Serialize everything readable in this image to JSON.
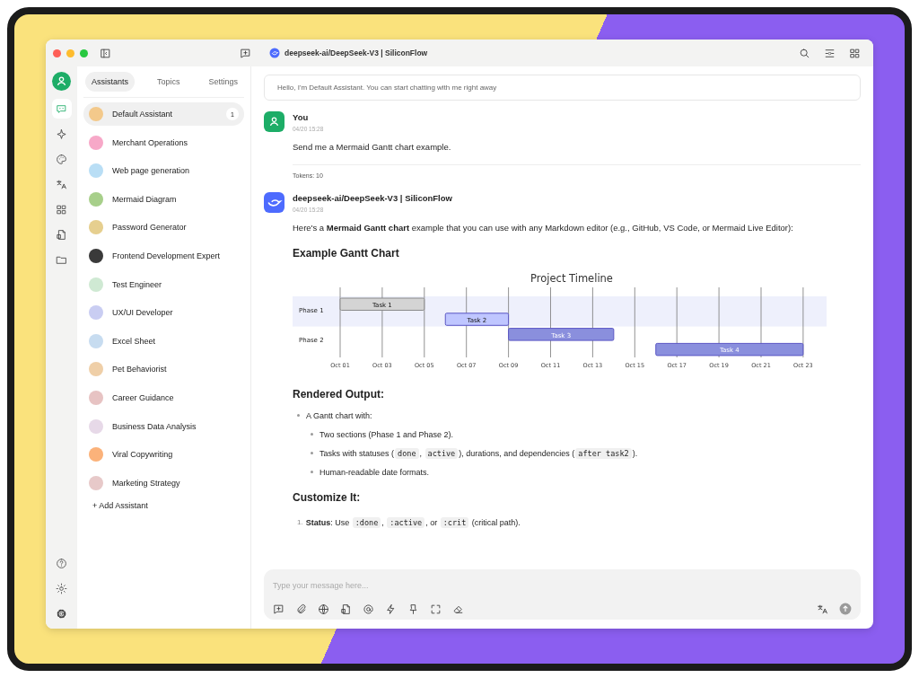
{
  "window": {
    "title": "deepseek-ai/DeepSeek-V3 | SiliconFlow"
  },
  "rail": {
    "top": [
      {
        "selected": true
      },
      {
        "selected": false
      },
      {
        "selected": false
      },
      {
        "selected": false
      },
      {
        "selected": false
      },
      {
        "selected": false
      },
      {
        "selected": false
      }
    ]
  },
  "sidebar": {
    "tabs": [
      {
        "label": "Assistants",
        "selected": true
      },
      {
        "label": "Topics",
        "selected": false
      },
      {
        "label": "Settings",
        "selected": false
      }
    ],
    "items": [
      {
        "label": "Default Assistant",
        "selected": true,
        "badge": "1",
        "color": "#f3c98b"
      },
      {
        "label": "Merchant Operations",
        "selected": false,
        "color": "#f7a8c8"
      },
      {
        "label": "Web page generation",
        "selected": false,
        "color": "#b9def5"
      },
      {
        "label": "Mermaid Diagram",
        "selected": false,
        "color": "#a7cf8a"
      },
      {
        "label": "Password Generator",
        "selected": false,
        "color": "#e6cf8f"
      },
      {
        "label": "Frontend Development Expert",
        "selected": false,
        "color": "#3a3a3a"
      },
      {
        "label": "Test Engineer",
        "selected": false,
        "color": "#cfe9d3"
      },
      {
        "label": "UX/UI Developer",
        "selected": false,
        "color": "#c9cdf2"
      },
      {
        "label": "Excel Sheet",
        "selected": false,
        "color": "#c7dcf0"
      },
      {
        "label": "Pet Behaviorist",
        "selected": false,
        "color": "#efcfa8"
      },
      {
        "label": "Career Guidance",
        "selected": false,
        "color": "#e7c3c3"
      },
      {
        "label": "Business Data Analysis",
        "selected": false,
        "color": "#e7d9e8"
      },
      {
        "label": "Viral Copywriting",
        "selected": false,
        "color": "#fbb27a"
      },
      {
        "label": "Marketing Strategy",
        "selected": false,
        "color": "#e7c9c9"
      }
    ],
    "add_label": "+ Add Assistant"
  },
  "chat": {
    "greeting": "Hello, I'm Default Assistant. You can start chatting with me right away",
    "messages": [
      {
        "kind": "user",
        "author": "You",
        "time": "04/20 15:28",
        "text": "Send me a Mermaid Gantt chart example.",
        "tokens": "Tokens: 10"
      },
      {
        "kind": "assistant",
        "author": "deepseek-ai/DeepSeek-V3 | SiliconFlow",
        "time": "04/20 15:28",
        "blocks": [
          {
            "kind": "paragraph",
            "segments": [
              {
                "kind": "text",
                "text": "Here's a "
              },
              {
                "kind": "bold",
                "text": "Mermaid Gantt chart"
              },
              {
                "kind": "text",
                "text": " example that you can use with any Markdown editor (e.g., GitHub, VS Code, or Mermaid Live Editor):"
              }
            ]
          },
          {
            "kind": "heading",
            "text": "Example Gantt Chart"
          },
          {
            "kind": "gantt",
            "gantt": {
              "title": "Project Timeline",
              "sections": [
                {
                  "label": "Phase 1",
                  "tasks": [
                    {
                      "label": "Task 1",
                      "kind": "done"
                    },
                    {
                      "label": "Task 2",
                      "kind": "active"
                    }
                  ]
                },
                {
                  "label": "Phase 2",
                  "tasks": [
                    {
                      "label": "Task 3",
                      "kind": "planned"
                    },
                    {
                      "label": "Task 4",
                      "kind": "planned"
                    }
                  ]
                }
              ],
              "ticks": [
                "Oct 01",
                "Oct 03",
                "Oct 05",
                "Oct 07",
                "Oct 09",
                "Oct 11",
                "Oct 13",
                "Oct 15",
                "Oct 17",
                "Oct 19",
                "Oct 21",
                "Oct 23"
              ]
            }
          },
          {
            "kind": "heading",
            "text": "Rendered Output:"
          },
          {
            "kind": "bullets",
            "items": [
              {
                "segments": [
                  {
                    "kind": "text",
                    "text": "A Gantt chart with:"
                  }
                ],
                "children": [
                  {
                    "segments": [
                      {
                        "kind": "text",
                        "text": "Two sections (Phase 1 and Phase 2)."
                      }
                    ]
                  },
                  {
                    "segments": [
                      {
                        "kind": "text",
                        "text": "Tasks with statuses ("
                      },
                      {
                        "kind": "code",
                        "text": "done"
                      },
                      {
                        "kind": "text",
                        "text": ", "
                      },
                      {
                        "kind": "code",
                        "text": "active"
                      },
                      {
                        "kind": "text",
                        "text": "), durations, and dependencies ("
                      },
                      {
                        "kind": "code",
                        "text": "after task2"
                      },
                      {
                        "kind": "text",
                        "text": ")."
                      }
                    ]
                  },
                  {
                    "segments": [
                      {
                        "kind": "text",
                        "text": "Human-readable date formats."
                      }
                    ]
                  }
                ]
              }
            ]
          },
          {
            "kind": "heading",
            "text": "Customize It:"
          },
          {
            "kind": "numbered",
            "items": [
              {
                "number": "1.",
                "segments": [
                  {
                    "kind": "bold",
                    "text": "Status"
                  },
                  {
                    "kind": "text",
                    "text": ": Use "
                  },
                  {
                    "kind": "code",
                    "text": ":done"
                  },
                  {
                    "kind": "text",
                    "text": ", "
                  },
                  {
                    "kind": "code",
                    "text": ":active"
                  },
                  {
                    "kind": "text",
                    "text": ", or "
                  },
                  {
                    "kind": "code",
                    "text": ":crit"
                  },
                  {
                    "kind": "text",
                    "text": " (critical path)."
                  }
                ]
              }
            ]
          }
        ]
      }
    ]
  },
  "composer": {
    "placeholder": "Type your message here..."
  }
}
